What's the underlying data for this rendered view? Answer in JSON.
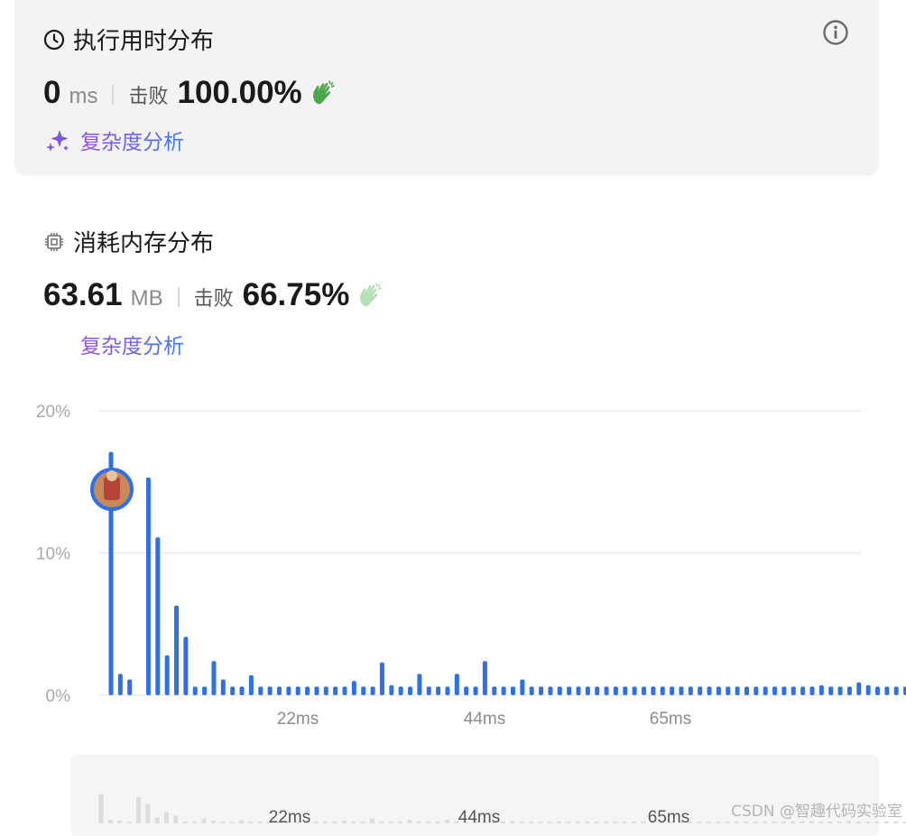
{
  "runtime": {
    "title": "执行用时分布",
    "value": "0",
    "unit": "ms",
    "beat_label": "击败",
    "percent": "100.00%",
    "analysis_label": "复杂度分析"
  },
  "memory": {
    "title": "消耗内存分布",
    "value": "63.61",
    "unit": "MB",
    "beat_label": "击败",
    "percent": "66.75%",
    "analysis_label": "复杂度分析"
  },
  "watermark": "CSDN @智趣代码实验室",
  "colors": {
    "bar": "#2f6fe8",
    "clap_active": "#4aa84a",
    "clap_muted": "#b5dfb5",
    "grid": "#e6e6e6"
  },
  "icons": {
    "runtime": "clock-icon",
    "memory": "chip-icon",
    "info": "info-icon",
    "analysis": "sparkle-icon",
    "beat": "clap-icon"
  },
  "chart_data": {
    "type": "bar",
    "ylabel_ticks": [
      "0%",
      "10%",
      "20%"
    ],
    "ylim": [
      0,
      20
    ],
    "x_tick_labels": [
      "22ms",
      "44ms",
      "65ms"
    ],
    "highlight_index": 0,
    "values": [
      17.1,
      1.5,
      1.1,
      0,
      15.3,
      11.1,
      2.8,
      6.3,
      4.1,
      0.6,
      0.6,
      2.4,
      1.1,
      0.6,
      0.6,
      1.4,
      0.6,
      0.6,
      0.6,
      0.6,
      0.6,
      0.6,
      0.6,
      0.6,
      0.6,
      0.6,
      1.0,
      0.6,
      0.6,
      2.3,
      0.7,
      0.6,
      0.6,
      1.5,
      0.6,
      0.6,
      0.6,
      1.5,
      0.6,
      0.6,
      2.4,
      0.6,
      0.6,
      0.6,
      1.1,
      0.6,
      0.6,
      0.6,
      0.6,
      0.6,
      0.6,
      0.6,
      0.6,
      0.6,
      0.6,
      0.6,
      0.6,
      0.6,
      0.6,
      0.6,
      0.6,
      0.6,
      0.6,
      0.6,
      0.6,
      0.6,
      0.6,
      0.6,
      0.6,
      0.6,
      0.6,
      0.6,
      0.6,
      0.6,
      0.6,
      0.6,
      0.7,
      0.6,
      0.6,
      0.6,
      0.9,
      0.7,
      0.6,
      0.6,
      0.6,
      0.6,
      0.6,
      0.6,
      0.6
    ],
    "grid": true,
    "legend": "none"
  }
}
